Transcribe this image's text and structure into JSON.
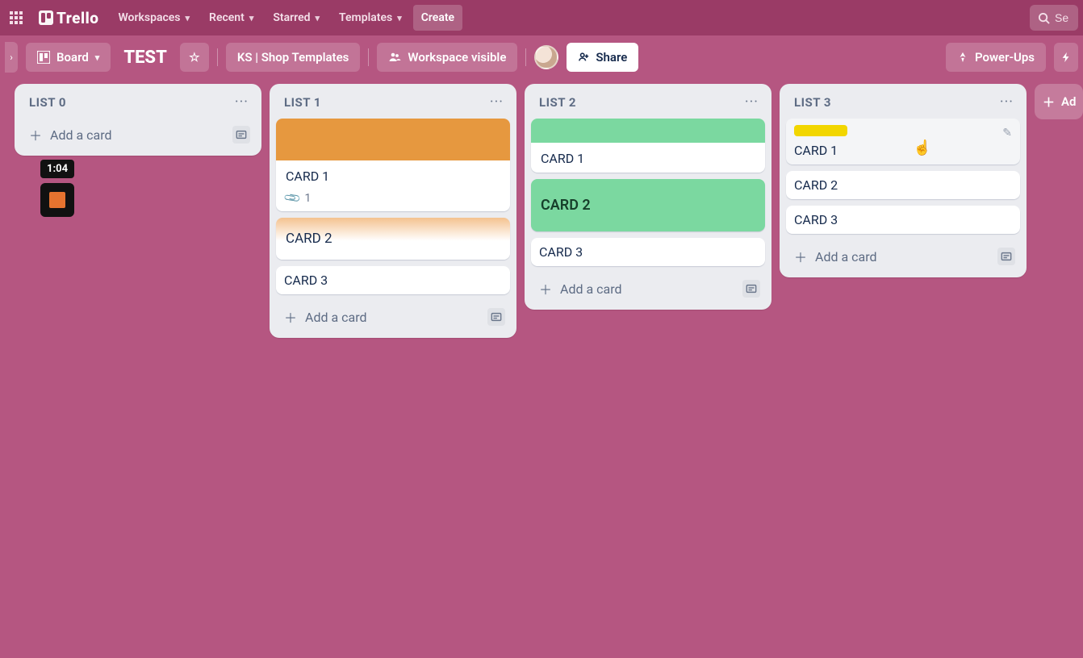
{
  "nav": {
    "brand": "Trello",
    "items": [
      {
        "label": "Workspaces"
      },
      {
        "label": "Recent"
      },
      {
        "label": "Starred"
      },
      {
        "label": "Templates"
      }
    ],
    "create": "Create",
    "search_placeholder": "Se"
  },
  "boardbar": {
    "board_view": "Board",
    "title": "TEST",
    "workspace_link": "KS | Shop Templates",
    "visibility": "Workspace visible",
    "share": "Share",
    "powerups": "Power-Ups",
    "add_list": "Ad"
  },
  "timer": {
    "elapsed": "1:04"
  },
  "lists": [
    {
      "title": "LIST 0",
      "add_card": "Add a card",
      "cards": []
    },
    {
      "title": "LIST 1",
      "add_card": "Add a card",
      "cards": [
        {
          "kind": "cover",
          "cover": "orange",
          "title": "CARD 1",
          "attach_count": "1"
        },
        {
          "kind": "grad-orange",
          "title": "CARD 2"
        },
        {
          "kind": "plain",
          "title": "CARD 3"
        }
      ]
    },
    {
      "title": "LIST 2",
      "add_card": "Add a card",
      "cards": [
        {
          "kind": "cover-short",
          "cover": "green",
          "title": "CARD 1"
        },
        {
          "kind": "solid-green",
          "title": "CARD 2"
        },
        {
          "kind": "plain",
          "title": "CARD 3"
        }
      ]
    },
    {
      "title": "LIST 3",
      "add_card": "Add a card",
      "cards": [
        {
          "kind": "label",
          "label": "yellow",
          "title": "CARD 1",
          "editing": true
        },
        {
          "kind": "plain",
          "title": "CARD 2"
        },
        {
          "kind": "plain",
          "title": "CARD 3"
        }
      ]
    }
  ]
}
